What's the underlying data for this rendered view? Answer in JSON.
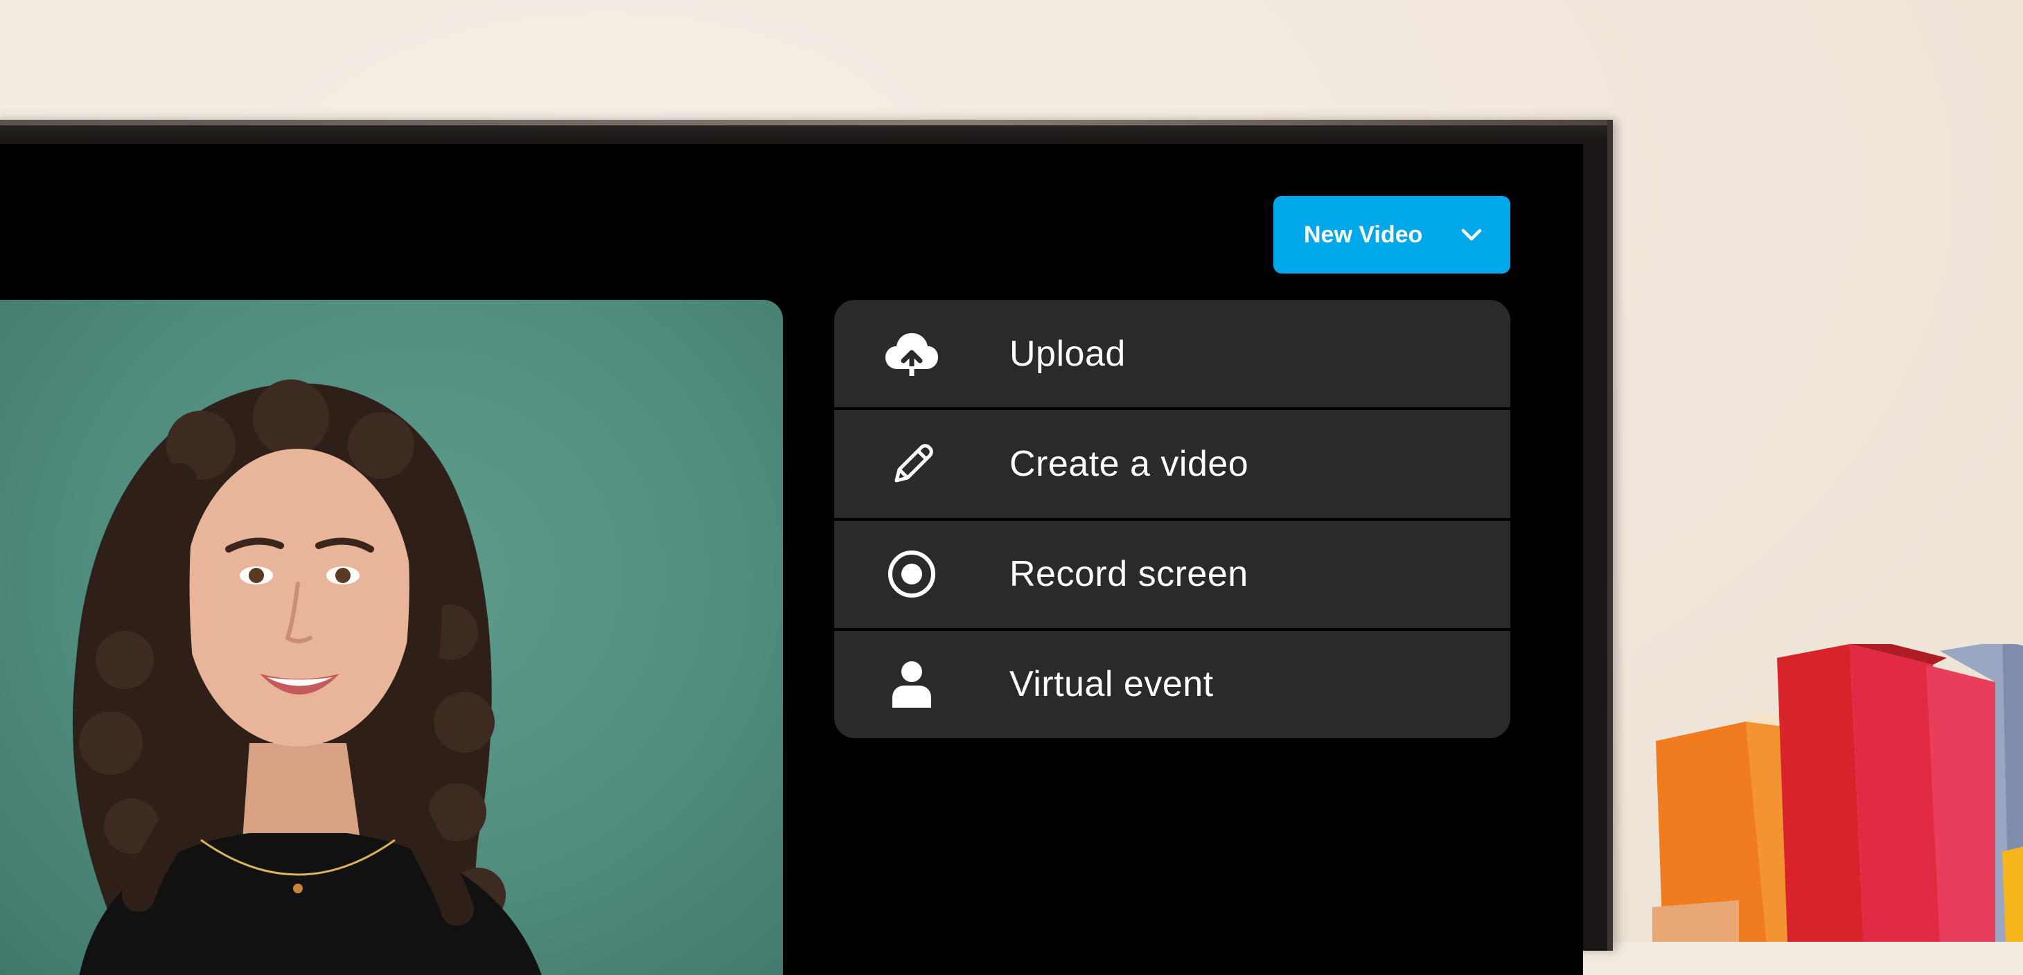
{
  "toolbar": {
    "new_video_label": "New Video",
    "dropdown_icon": "chevron-down-icon",
    "accent_color": "#00a8ea"
  },
  "menu": {
    "items": [
      {
        "label": "Upload",
        "icon": "cloud-upload-icon"
      },
      {
        "label": "Create a video",
        "icon": "pencil-icon"
      },
      {
        "label": "Record screen",
        "icon": "record-icon"
      },
      {
        "label": "Virtual event",
        "icon": "person-icon"
      }
    ],
    "background_color": "#2a2a2a"
  },
  "preview": {
    "background_color": "#4f8c7e"
  }
}
